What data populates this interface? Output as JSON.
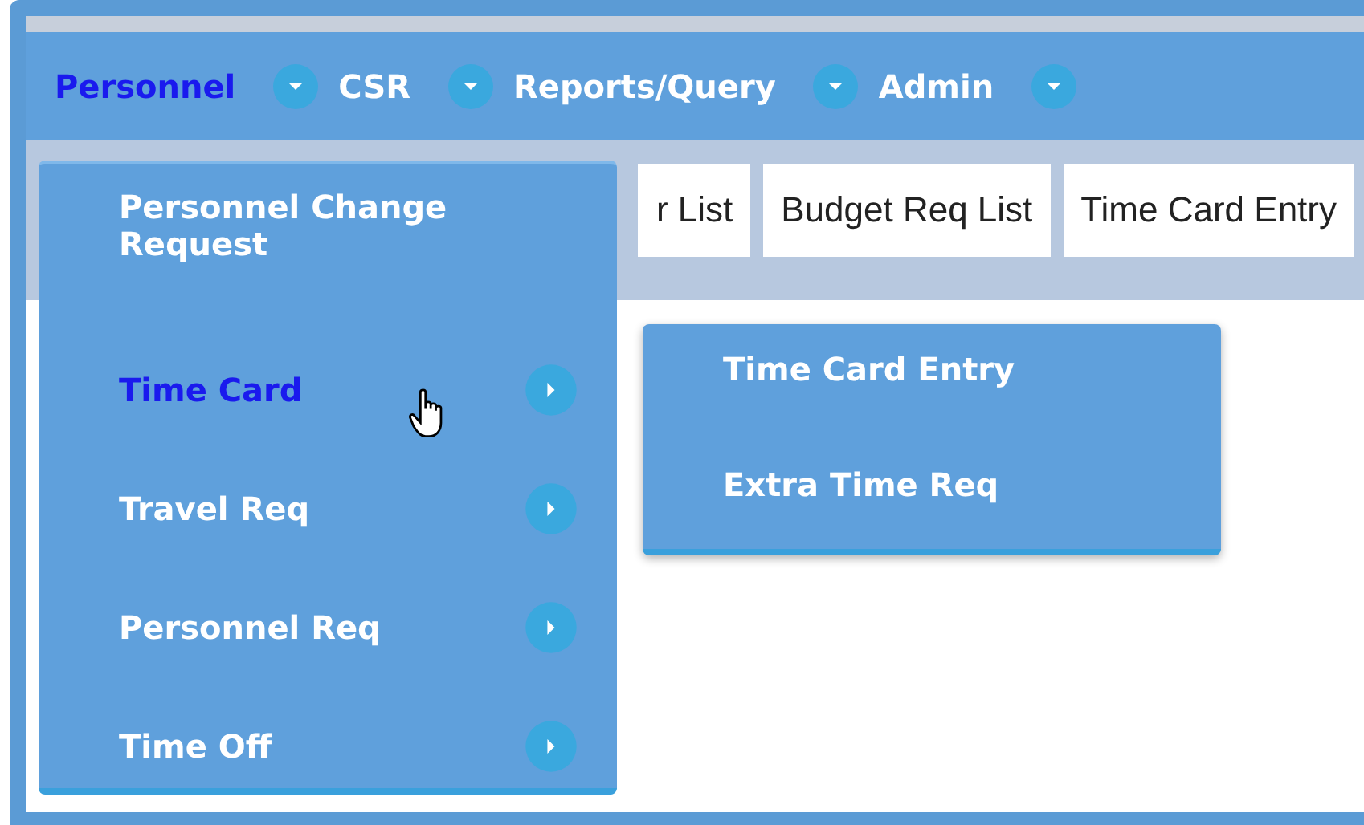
{
  "menubar": [
    {
      "label": "Personnel",
      "selected": true
    },
    {
      "label": "CSR",
      "selected": false
    },
    {
      "label": "Reports/Query",
      "selected": false
    },
    {
      "label": "Admin",
      "selected": false
    }
  ],
  "tabs": [
    "r List",
    "Budget Req List",
    "Time Card Entry"
  ],
  "dropdown": [
    {
      "label": "Personnel Change Request",
      "selected": false,
      "submenu": false
    },
    {
      "label": "Time Card",
      "selected": true,
      "submenu": true
    },
    {
      "label": "Travel Req",
      "selected": false,
      "submenu": true
    },
    {
      "label": "Personnel Req",
      "selected": false,
      "submenu": true
    },
    {
      "label": "Time Off",
      "selected": false,
      "submenu": true
    }
  ],
  "submenu": [
    "Time Card Entry",
    "Extra Time Req"
  ]
}
